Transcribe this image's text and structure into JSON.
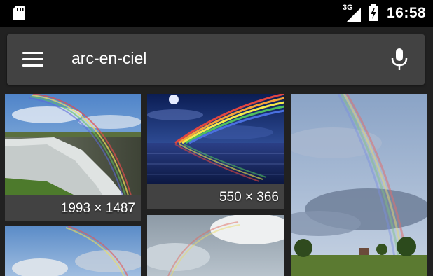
{
  "status_bar": {
    "network": "3G",
    "time": "16:58"
  },
  "search": {
    "query": "arc-en-ciel",
    "menu_icon": "hamburger-menu-icon",
    "voice_icon": "microphone-icon"
  },
  "results": [
    {
      "caption": "1993 × 1487"
    },
    {
      "caption": "550 × 366"
    },
    {
      "caption": ""
    },
    {
      "caption": ""
    },
    {
      "caption": ""
    }
  ],
  "colors": {
    "background": "#212121",
    "status_bar": "#000000",
    "search_bar": "#424242",
    "text": "#ffffff"
  }
}
